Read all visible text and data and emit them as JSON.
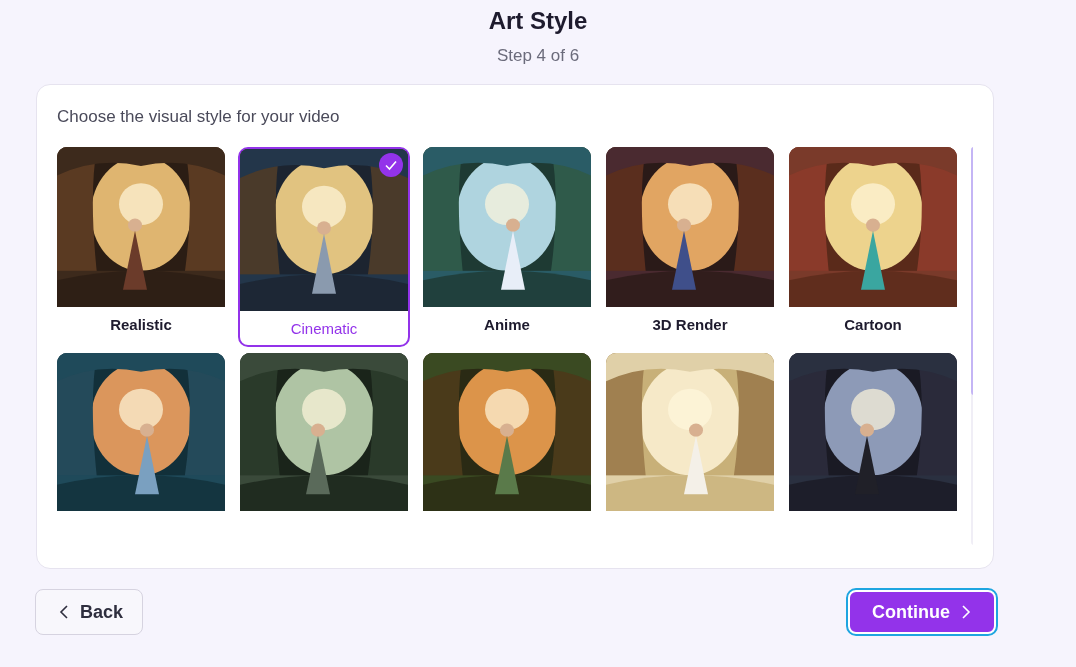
{
  "header": {
    "title": "Art Style",
    "subtitle": "Step 4 of 6"
  },
  "prompt": "Choose the visual style for your video",
  "styles": [
    {
      "label": "Realistic",
      "selected": false
    },
    {
      "label": "Cinematic",
      "selected": true
    },
    {
      "label": "Anime",
      "selected": false
    },
    {
      "label": "3D Render",
      "selected": false
    },
    {
      "label": "Cartoon",
      "selected": false
    },
    {
      "selected": false
    },
    {
      "selected": false
    },
    {
      "selected": false
    },
    {
      "selected": false
    },
    {
      "selected": false
    }
  ],
  "buttons": {
    "back": "Back",
    "continue": "Continue"
  }
}
